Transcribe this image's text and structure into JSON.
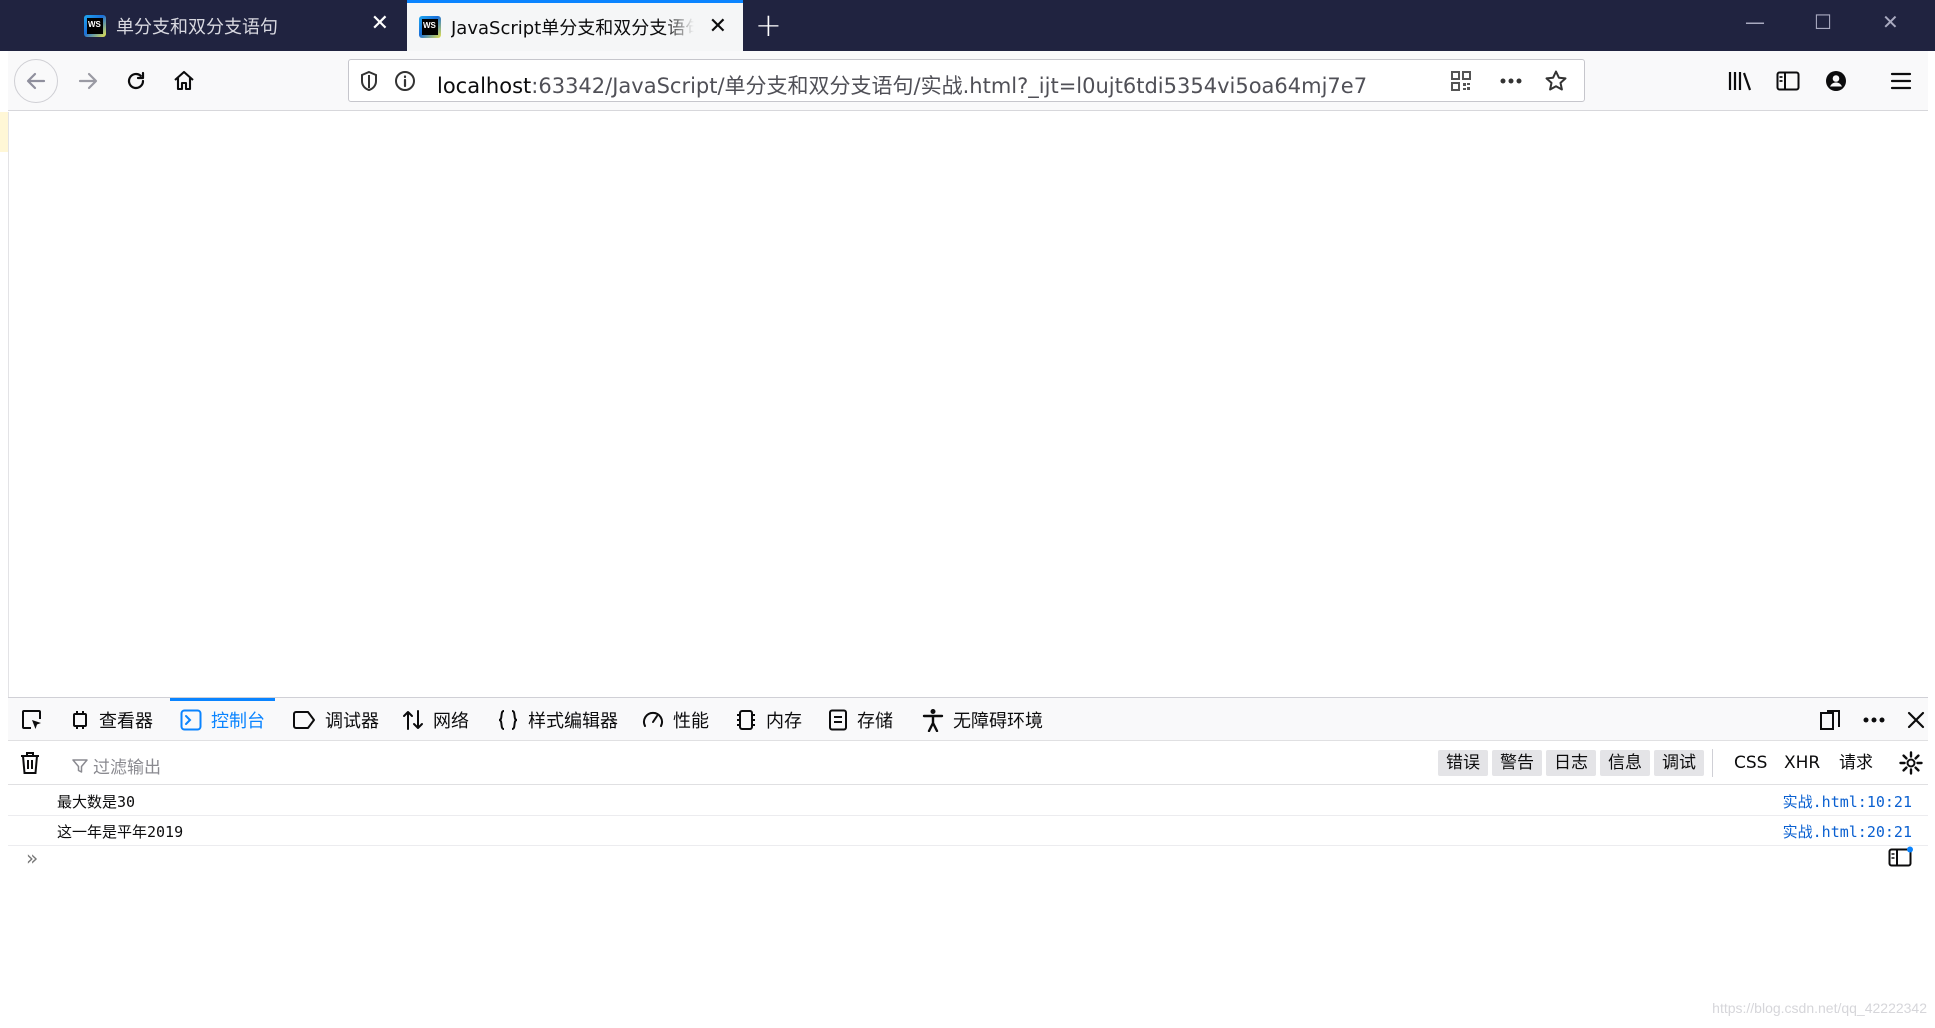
{
  "tabs": [
    {
      "title": "单分支和双分支语句",
      "close": "✕",
      "favicon": "WS"
    },
    {
      "title": "JavaScript单分支和双分支语句",
      "close": "✕",
      "favicon": "WS"
    }
  ],
  "new_tab": "+",
  "window_controls": {
    "minimize": "—",
    "maximize": "☐",
    "close": "✕"
  },
  "url": {
    "host": "localhost",
    "rest": ":63342/JavaScript/单分支和双分支语句/实战.html?_ijt=l0ujt6tdi5354vi5oa64mj7e7"
  },
  "devtools": {
    "tabs": [
      {
        "label": "查看器",
        "icon": "inspector-icon"
      },
      {
        "label": "控制台",
        "icon": "console-icon",
        "active": true
      },
      {
        "label": "调试器",
        "icon": "debugger-icon"
      },
      {
        "label": "网络",
        "icon": "network-icon"
      },
      {
        "label": "样式编辑器",
        "icon": "style-editor-icon"
      },
      {
        "label": "性能",
        "icon": "performance-icon"
      },
      {
        "label": "内存",
        "icon": "memory-icon"
      },
      {
        "label": "存储",
        "icon": "storage-icon"
      },
      {
        "label": "无障碍环境",
        "icon": "accessibility-icon"
      }
    ],
    "filter_placeholder": "过滤输出",
    "levels": [
      "错误",
      "警告",
      "日志",
      "信息",
      "调试"
    ],
    "extra_filters": [
      "CSS",
      "XHR",
      "请求"
    ],
    "messages": [
      {
        "text": "最大数是30",
        "location": "实战.html:10:21"
      },
      {
        "text": "这一年是平年2019",
        "location": "实战.html:20:21"
      }
    ],
    "prompt": "»"
  },
  "watermark": "https://blog.csdn.net/qq_42222342",
  "colors": {
    "accent": "#0a84ff",
    "titlebar": "#202340",
    "link": "#0a60d1"
  }
}
